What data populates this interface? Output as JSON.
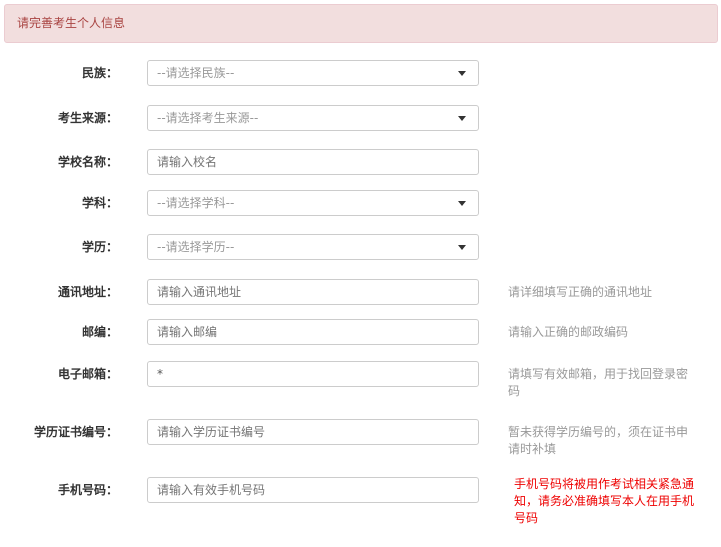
{
  "alert": "请完善考生个人信息",
  "fields": [
    {
      "label": "民族：",
      "type": "select",
      "value": "--请选择民族--"
    },
    {
      "label": "考生来源：",
      "type": "select",
      "value": "--请选择考生来源--"
    },
    {
      "label": "学校名称：",
      "type": "input",
      "placeholder": "请输入校名"
    },
    {
      "label": "学科：",
      "type": "select",
      "value": "--请选择学科--"
    },
    {
      "label": "学历：",
      "type": "select",
      "value": "--请选择学历--"
    },
    {
      "label": "通讯地址：",
      "type": "input",
      "placeholder": "请输入通讯地址",
      "help": "请详细填写正确的通讯地址"
    },
    {
      "label": "邮编：",
      "type": "input",
      "placeholder": "请输入邮编",
      "help": "请输入正确的邮政编码"
    },
    {
      "label": "电子邮箱：",
      "type": "input",
      "value": "*",
      "help": "请填写有效邮箱，用于找回登录密码"
    },
    {
      "label": "学历证书编号：",
      "type": "input",
      "placeholder": "请输入学历证书编号",
      "help": "暂未获得学历编号的，须在证书申请时补填"
    },
    {
      "label": "手机号码：",
      "type": "input",
      "placeholder": "请输入有效手机号码",
      "help": "手机号码将被用作考试相关紧急通知，请务必准确填写本人在用手机号码",
      "help_color": "#e00000"
    }
  ]
}
